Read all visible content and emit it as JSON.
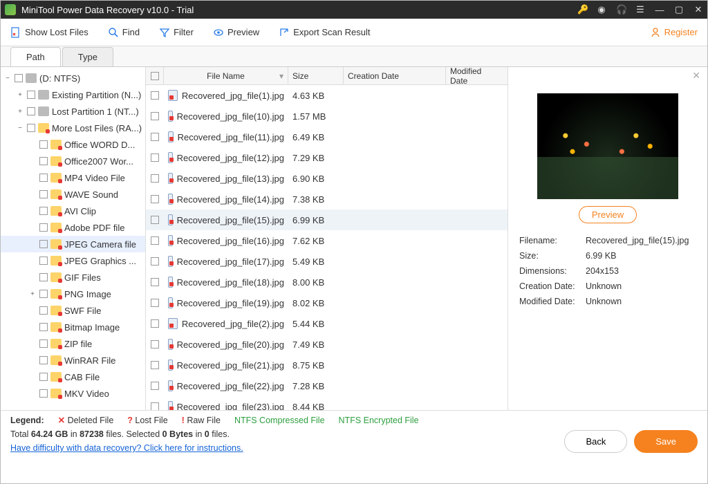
{
  "title": "MiniTool Power Data Recovery v10.0 - Trial",
  "toolbar": {
    "show_lost": "Show Lost Files",
    "find": "Find",
    "filter": "Filter",
    "preview": "Preview",
    "export": "Export Scan Result",
    "register": "Register"
  },
  "tabs": {
    "path": "Path",
    "type": "Type"
  },
  "tree": [
    {
      "depth": 0,
      "exp": "−",
      "icon": "drive",
      "label": "(D: NTFS)"
    },
    {
      "depth": 1,
      "exp": "+",
      "icon": "drive",
      "label": "Existing Partition (N...)"
    },
    {
      "depth": 1,
      "exp": "+",
      "icon": "drive",
      "label": "Lost Partition 1 (NT...)"
    },
    {
      "depth": 1,
      "exp": "−",
      "icon": "folder-red",
      "label": "More Lost Files (RA...)"
    },
    {
      "depth": 2,
      "exp": "",
      "icon": "folder-red",
      "label": "Office WORD D..."
    },
    {
      "depth": 2,
      "exp": "",
      "icon": "folder-red",
      "label": "Office2007 Wor..."
    },
    {
      "depth": 2,
      "exp": "",
      "icon": "folder-red",
      "label": "MP4 Video File"
    },
    {
      "depth": 2,
      "exp": "",
      "icon": "folder-red",
      "label": "WAVE Sound"
    },
    {
      "depth": 2,
      "exp": "",
      "icon": "folder-red",
      "label": "AVI Clip"
    },
    {
      "depth": 2,
      "exp": "",
      "icon": "folder-red",
      "label": "Adobe PDF file"
    },
    {
      "depth": 2,
      "exp": "",
      "icon": "folder-red",
      "label": "JPEG Camera file",
      "selected": true
    },
    {
      "depth": 2,
      "exp": "",
      "icon": "folder-red",
      "label": "JPEG Graphics ..."
    },
    {
      "depth": 2,
      "exp": "",
      "icon": "folder-red",
      "label": "GIF Files"
    },
    {
      "depth": 2,
      "exp": "+",
      "icon": "folder-red",
      "label": "PNG Image"
    },
    {
      "depth": 2,
      "exp": "",
      "icon": "folder-red",
      "label": "SWF File"
    },
    {
      "depth": 2,
      "exp": "",
      "icon": "folder-red",
      "label": "Bitmap Image"
    },
    {
      "depth": 2,
      "exp": "",
      "icon": "folder-red",
      "label": "ZIP file"
    },
    {
      "depth": 2,
      "exp": "",
      "icon": "folder-red",
      "label": "WinRAR File"
    },
    {
      "depth": 2,
      "exp": "",
      "icon": "folder-red",
      "label": "CAB File"
    },
    {
      "depth": 2,
      "exp": "",
      "icon": "folder-red",
      "label": "MKV Video"
    }
  ],
  "columns": {
    "name": "File Name",
    "size": "Size",
    "cd": "Creation Date",
    "md": "Modified Date"
  },
  "files": [
    {
      "name": "Recovered_jpg_file(1).jpg",
      "size": "4.63 KB"
    },
    {
      "name": "Recovered_jpg_file(10).jpg",
      "size": "1.57 MB"
    },
    {
      "name": "Recovered_jpg_file(11).jpg",
      "size": "6.49 KB"
    },
    {
      "name": "Recovered_jpg_file(12).jpg",
      "size": "7.29 KB"
    },
    {
      "name": "Recovered_jpg_file(13).jpg",
      "size": "6.90 KB"
    },
    {
      "name": "Recovered_jpg_file(14).jpg",
      "size": "7.38 KB"
    },
    {
      "name": "Recovered_jpg_file(15).jpg",
      "size": "6.99 KB",
      "selected": true
    },
    {
      "name": "Recovered_jpg_file(16).jpg",
      "size": "7.62 KB"
    },
    {
      "name": "Recovered_jpg_file(17).jpg",
      "size": "5.49 KB"
    },
    {
      "name": "Recovered_jpg_file(18).jpg",
      "size": "8.00 KB"
    },
    {
      "name": "Recovered_jpg_file(19).jpg",
      "size": "8.02 KB"
    },
    {
      "name": "Recovered_jpg_file(2).jpg",
      "size": "5.44 KB"
    },
    {
      "name": "Recovered_jpg_file(20).jpg",
      "size": "7.49 KB"
    },
    {
      "name": "Recovered_jpg_file(21).jpg",
      "size": "8.75 KB"
    },
    {
      "name": "Recovered_jpg_file(22).jpg",
      "size": "7.28 KB"
    },
    {
      "name": "Recovered_jpg_file(23).jpg",
      "size": "8.44 KB"
    }
  ],
  "preview": {
    "button": "Preview",
    "labels": {
      "fn": "Filename:",
      "sz": "Size:",
      "dim": "Dimensions:",
      "cd": "Creation Date:",
      "md": "Modified Date:"
    },
    "filename": "Recovered_jpg_file(15).jpg",
    "size": "6.99 KB",
    "dimensions": "204x153",
    "creation": "Unknown",
    "modified": "Unknown"
  },
  "legend": {
    "title": "Legend:",
    "deleted": "Deleted File",
    "lost": "Lost File",
    "raw": "Raw File",
    "compressed": "NTFS Compressed File",
    "encrypted": "NTFS Encrypted File"
  },
  "status": {
    "summary_prefix": "Total ",
    "total_size": "64.24 GB",
    "in": " in ",
    "total_files": "87238",
    "files_word": " files.   Selected ",
    "sel_bytes": "0 Bytes",
    "in2": " in ",
    "sel_files": "0",
    "files2": " files.",
    "help": "Have difficulty with data recovery? Click here for instructions."
  },
  "buttons": {
    "back": "Back",
    "save": "Save"
  }
}
